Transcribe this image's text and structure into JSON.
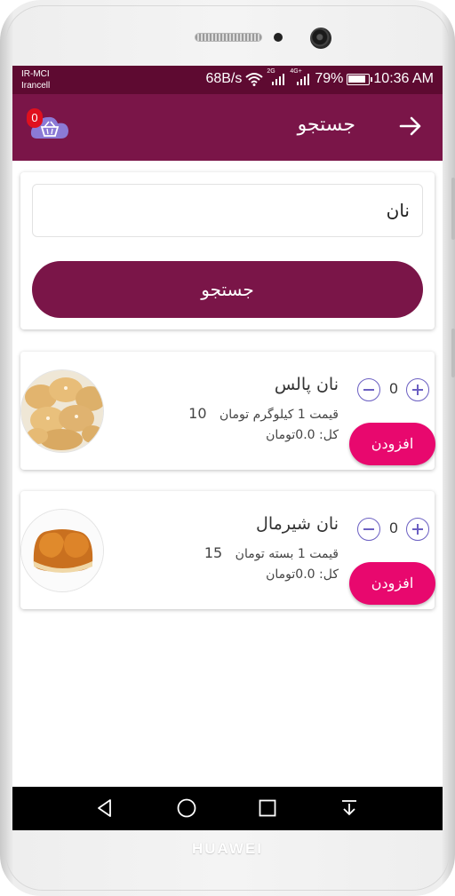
{
  "status": {
    "carrier_line1": "IR-MCI",
    "carrier_line2": "Irancell",
    "speed": "68B/s",
    "net1": "2G",
    "net2": "4G+",
    "battery": "79%",
    "time": "10:36 AM"
  },
  "appbar": {
    "title": "جستجو",
    "cart_count": "0"
  },
  "search": {
    "value": "نان",
    "button_label": "جستجو"
  },
  "products": [
    {
      "name": "نان پالس",
      "price_text": "قیمت 1 کیلوگرم تومان",
      "price_value": "10",
      "total": "کل: 0.0تومان",
      "qty": "0",
      "add_label": "افزودن"
    },
    {
      "name": "نان شیرمال",
      "price_text": "قیمت 1 بسته تومان",
      "price_value": "15",
      "total": "کل: 0.0تومان",
      "qty": "0",
      "add_label": "افزودن"
    }
  ],
  "device": {
    "brand": "HUAWEI"
  }
}
